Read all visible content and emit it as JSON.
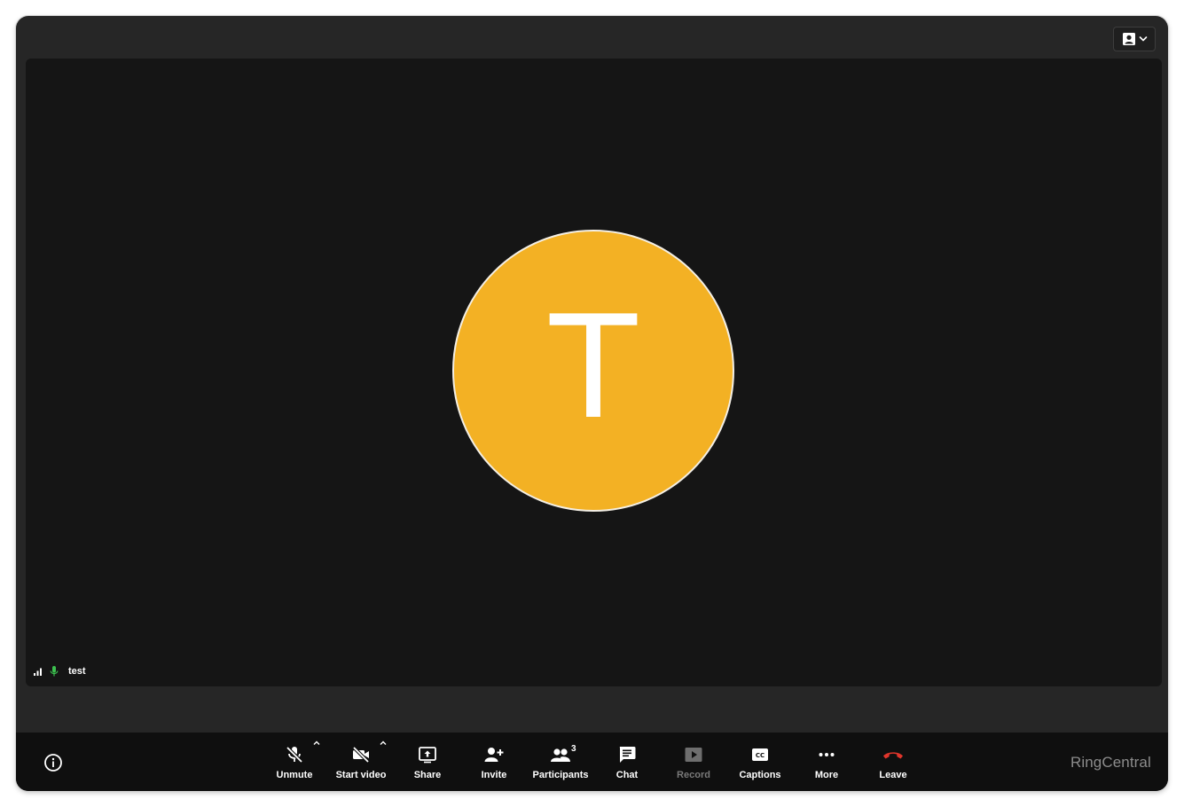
{
  "meeting": {
    "participant_name": "test",
    "avatar_initial": "T",
    "avatar_color": "#f3b124",
    "participant_count": "3"
  },
  "header": {
    "view_icon": "speaker-view-icon"
  },
  "toolbar": {
    "unmute_label": "Unmute",
    "start_video_label": "Start video",
    "share_label": "Share",
    "invite_label": "Invite",
    "participants_label": "Participants",
    "chat_label": "Chat",
    "record_label": "Record",
    "captions_label": "Captions",
    "more_label": "More",
    "leave_label": "Leave",
    "leave_color": "#e0352b"
  },
  "brand": {
    "name": "RingCentral"
  }
}
